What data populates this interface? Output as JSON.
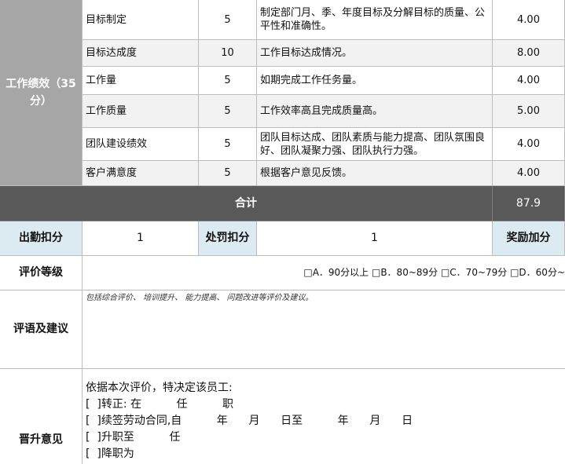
{
  "performance": {
    "category": "工作绩效（35分）",
    "rows": [
      {
        "item": "目标制定",
        "weight": "5",
        "desc": "制定部门月、季、年度目标及分解目标的质量、公平性和准确性。",
        "score": "4.00"
      },
      {
        "item": "目标达成度",
        "weight": "10",
        "desc": "工作目标达成情况。",
        "score": "8.00"
      },
      {
        "item": "工作量",
        "weight": "5",
        "desc": "如期完成工作任务量。",
        "score": "4.00"
      },
      {
        "item": "工作质量",
        "weight": "5",
        "desc": "工作效率高且完成质量高。",
        "score": "5.00"
      },
      {
        "item": "团队建设绩效",
        "weight": "5",
        "desc": "团队目标达成、团队素质与能力提高、团队氛围良好、团队凝聚力强、团队执行力强。",
        "score": "4.00"
      },
      {
        "item": "客户满意度",
        "weight": "5",
        "desc": "根据客户意见反馈。",
        "score": "4.00"
      }
    ]
  },
  "total": {
    "label": "合计",
    "value": "87.9"
  },
  "deductions": {
    "attendance_label": "出勤扣分",
    "attendance_value": "1",
    "penalty_label": "处罚扣分",
    "penalty_value": "1",
    "bonus_label": "奖励加分"
  },
  "grade": {
    "label": "评价等级",
    "options": "□A．90分以上 □B．80~89分 □C．70~79分 □D．60分~"
  },
  "comments": {
    "label": "评语及建议",
    "hint": "包括综合评价、 培训提升、 能力提高、 问题改进等评价及建议。"
  },
  "promotion": {
    "label": "晋升意见",
    "lines": [
      "依据本次评价，特决定该员工:",
      "[  ]转正: 在          任          职",
      "[  ]续签劳动合同,自          年      月      日至          年      月      日",
      "[  ]升职至          任",
      "[  ]降职为"
    ]
  }
}
